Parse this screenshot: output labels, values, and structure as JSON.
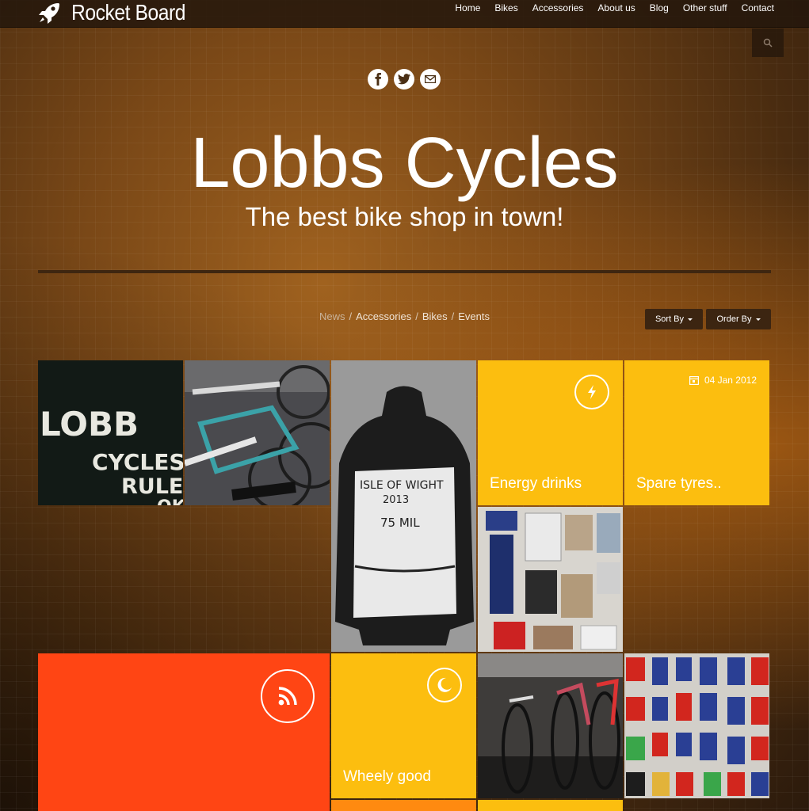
{
  "brand": {
    "name": "Rocket Board",
    "icon": "rocket-icon"
  },
  "nav": [
    "Home",
    "Bikes",
    "Accessories",
    "About us",
    "Blog",
    "Other stuff",
    "Contact"
  ],
  "search": {
    "icon": "search-icon"
  },
  "social": [
    "facebook-icon",
    "twitter-icon",
    "email-icon"
  ],
  "hero": {
    "title": "Lobbs Cycles",
    "subtitle": "The best bike shop in town!"
  },
  "filters": {
    "items": [
      "News",
      "Accessories",
      "Bikes",
      "Events"
    ],
    "separator": "/"
  },
  "sort": {
    "sort_by": "Sort By",
    "order_by": "Order By"
  },
  "tiles": {
    "energy": {
      "title": "Energy drinks",
      "icon": "lightning-icon"
    },
    "tyres": {
      "title": "Spare tyres..",
      "date": "04 Jan 2012",
      "icon": "calendar-icon"
    },
    "rss": {
      "icon": "rss-icon"
    },
    "wheely": {
      "title": "Wheely good",
      "icon": "moon-icon"
    }
  },
  "photos": {
    "lobb": [
      "LOBB",
      "CYCLES",
      "RULE",
      "OK"
    ],
    "jersey": [
      "ISLE OF WIGHT",
      "2013",
      "75 MIL"
    ]
  },
  "colors": {
    "yellow": "#fcbe0f",
    "orange": "#ff4514",
    "nav_bg": "#23160c"
  }
}
